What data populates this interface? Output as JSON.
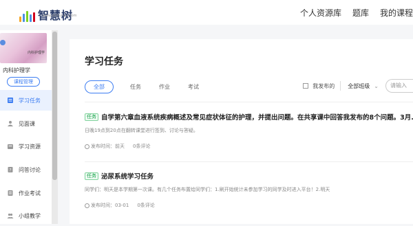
{
  "brand": {
    "name": "智慧树",
    "url": "www.zhihuishu.com",
    "logo_bar_colors": [
      "#f5a623",
      "#4a90e2",
      "#7ed321",
      "#4a90e2",
      "#d0021b"
    ]
  },
  "topnav": {
    "items": [
      "个人资源库",
      "题库",
      "我的课程"
    ]
  },
  "sidebar": {
    "course_name": "内科护理学",
    "cover_text": "内科护理学",
    "manage_label": "课程管理",
    "items": [
      {
        "label": "学习任务",
        "icon": "task-list-icon",
        "active": true
      },
      {
        "label": "见面课",
        "icon": "person-icon",
        "active": false
      },
      {
        "label": "学习资源",
        "icon": "folder-icon",
        "active": false
      },
      {
        "label": "问答讨论",
        "icon": "discussion-icon",
        "active": false
      },
      {
        "label": "作业考试",
        "icon": "exam-icon",
        "active": false
      },
      {
        "label": "小组教学",
        "icon": "group-icon",
        "active": false
      }
    ]
  },
  "main": {
    "title": "学习任务",
    "tabs": [
      "全部",
      "任务",
      "作业",
      "考试"
    ],
    "active_tab": "全部",
    "filters": {
      "my_published_label": "我发布的",
      "class_select": "全部班级",
      "search_placeholder": "请输入"
    },
    "tasks": [
      {
        "badge": "任务",
        "title": "自学第六章血液系统疾病概述及常见症状体征的护理，并提出问题。在共享课中回答我发布的8个问题。3月...",
        "desc": "日晚19点到20点在翻转课堂进行签到、讨论与答疑。",
        "published": "发布时间：前天",
        "comments": "0条评论"
      },
      {
        "badge": "任务",
        "title": "泌尿系统学习任务",
        "desc": "同学们：明天是本学期第一次课。有几个任务布置给同学们：1.刷开始统计未参加学习的同学及时进入平台！2.明天",
        "published": "发布时间：03-01",
        "comments": "0条评论"
      }
    ]
  },
  "colors": {
    "accent": "#3b7cf2",
    "badge_green": "#17a34a"
  }
}
